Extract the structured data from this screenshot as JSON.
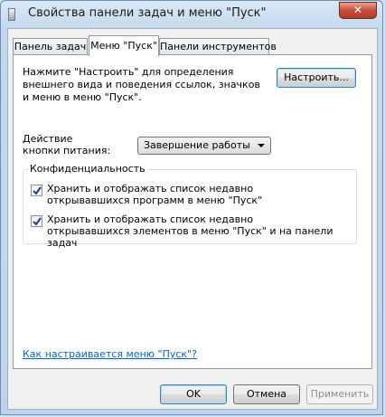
{
  "window": {
    "title": "Свойства панели задач и меню \"Пуск\"",
    "close_label": "✕"
  },
  "tabs": [
    {
      "label": "Панель задач",
      "active": false
    },
    {
      "label": "Меню \"Пуск\"",
      "active": true
    },
    {
      "label": "Панели инструментов",
      "active": false
    }
  ],
  "start_menu": {
    "description": "Нажмите \"Настроить\" для определения внешнего вида и поведения ссылок, значков и меню в меню \"Пуск\".",
    "customize_label": "Настроить...",
    "power_label": "Действие кнопки питания:",
    "power_value": "Завершение работы",
    "privacy": {
      "title": "Конфиденциальность",
      "items": [
        {
          "label": "Хранить и отображать список недавно открывавшихся программ в меню \"Пуск\"",
          "checked": true
        },
        {
          "label": "Хранить и отображать список недавно открывавшихся элементов в меню \"Пуск\" и на панели задач",
          "checked": true
        }
      ]
    },
    "help_link": "Как настраивается меню \"Пуск\"?"
  },
  "footer": {
    "ok_label": "OK",
    "cancel_label": "Отмена",
    "apply_label": "Применить"
  },
  "colors": {
    "link": "#0066cc",
    "default_button_border": "#3c7fb1"
  }
}
